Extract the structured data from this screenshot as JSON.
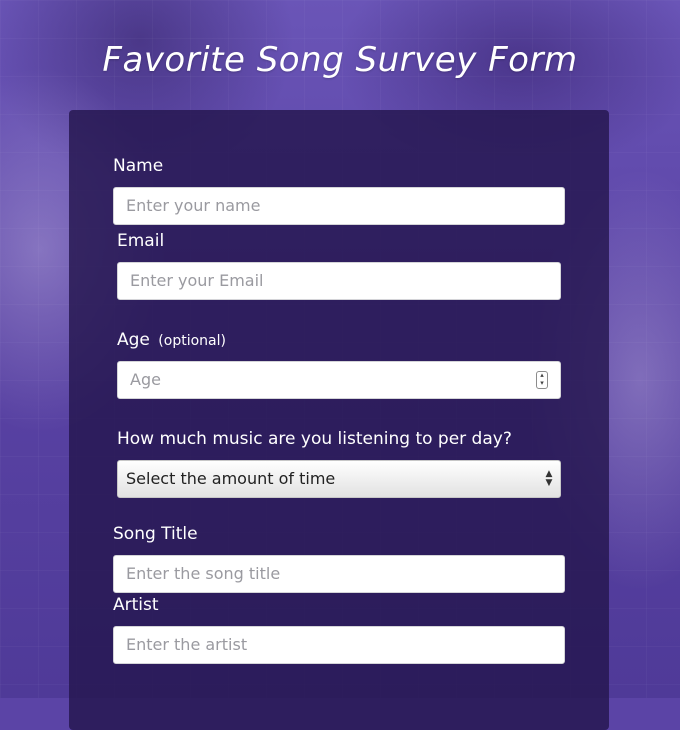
{
  "page": {
    "title": "Favorite Song Survey Form"
  },
  "form": {
    "name_label": "Name",
    "name_placeholder": "Enter your name",
    "email_label": "Email",
    "email_placeholder": "Enter your Email",
    "age_label": "Age",
    "age_optional": "(optional)",
    "age_placeholder": "Age",
    "listening_label": "How much music are you listening to per day?",
    "listening_selected": "Select the amount of time",
    "song_title_label": "Song Title",
    "song_title_placeholder": "Enter the song title",
    "artist_label": "Artist",
    "artist_placeholder": "Enter the artist"
  },
  "icons": {
    "number_spinner": "number-spinner-icon",
    "select_arrows": "select-arrows-icon"
  },
  "colors": {
    "background": "#5b44a6",
    "card": "#24164e",
    "text": "#ffffff",
    "placeholder": "#9a9aa0"
  }
}
